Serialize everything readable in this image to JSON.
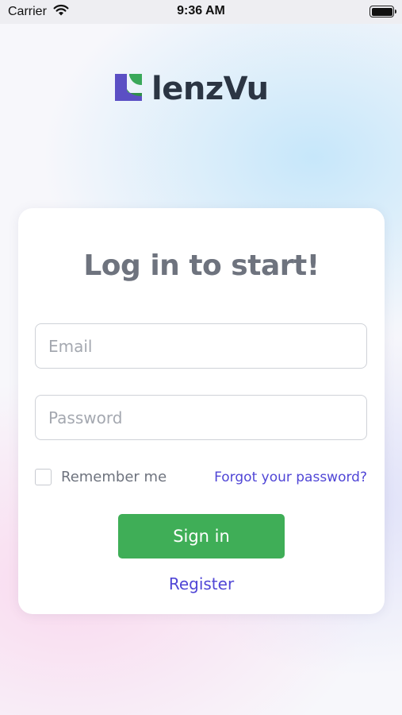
{
  "status_bar": {
    "carrier": "Carrier",
    "time": "9:36 AM",
    "battery_icon": "battery-full-icon",
    "signal_icon": "wifi-icon"
  },
  "brand": {
    "name": "lenzVu",
    "logo_icon": "lenzvu-logo-mark",
    "mark_colors": [
      "#5b4fc4",
      "#3aa85a"
    ]
  },
  "login": {
    "title": "Log in to start!",
    "email_placeholder": "Email",
    "email_value": "",
    "password_placeholder": "Password",
    "password_value": "",
    "remember_label": "Remember me",
    "remember_checked": false,
    "forgot_label": "Forgot your password?",
    "signin_label": "Sign in",
    "register_label": "Register"
  },
  "colors": {
    "primary_button": "#3fae57",
    "link": "#5046d6",
    "title_text": "#6e737e",
    "logo_text": "#2b3543"
  }
}
